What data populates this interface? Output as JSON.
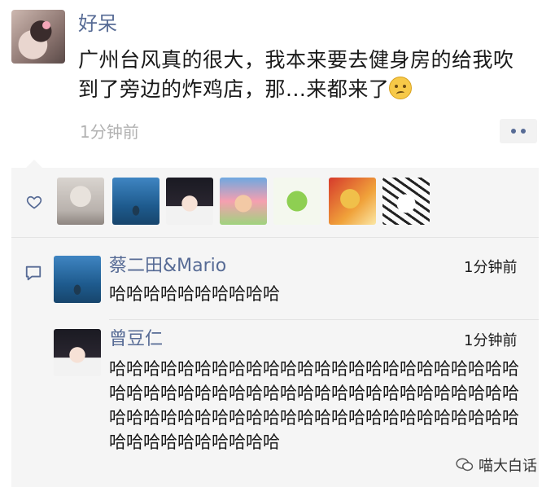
{
  "post": {
    "author": "好呆",
    "text": "广州台风真的很大，我本来要去健身房的给我吹到了旁边的炸鸡店，那...来都来了",
    "emoji_icon": "face-emoji-icon",
    "time": "1分钟前"
  },
  "likes": {
    "icon": "heart-icon",
    "count": 7
  },
  "comments": [
    {
      "author": "蔡二田&Mario",
      "time": "1分钟前",
      "text": "哈哈哈哈哈哈哈哈哈哈"
    },
    {
      "author": "曾豆仁",
      "time": "1分钟前",
      "text": "哈哈哈哈哈哈哈哈哈哈哈哈哈哈哈哈哈哈哈哈哈哈哈哈哈哈哈哈哈哈哈哈哈哈哈哈哈哈哈哈哈哈哈哈哈哈哈哈哈哈哈哈哈哈哈哈哈哈哈哈哈哈哈哈哈哈哈哈哈哈哈哈哈哈哈哈哈哈哈哈哈哈"
    }
  ],
  "watermark": "喵大白话",
  "colors": {
    "name_blue": "#576b95",
    "panel_bg": "#f5f5f5",
    "timestamp_gray": "#b2b2b2"
  }
}
